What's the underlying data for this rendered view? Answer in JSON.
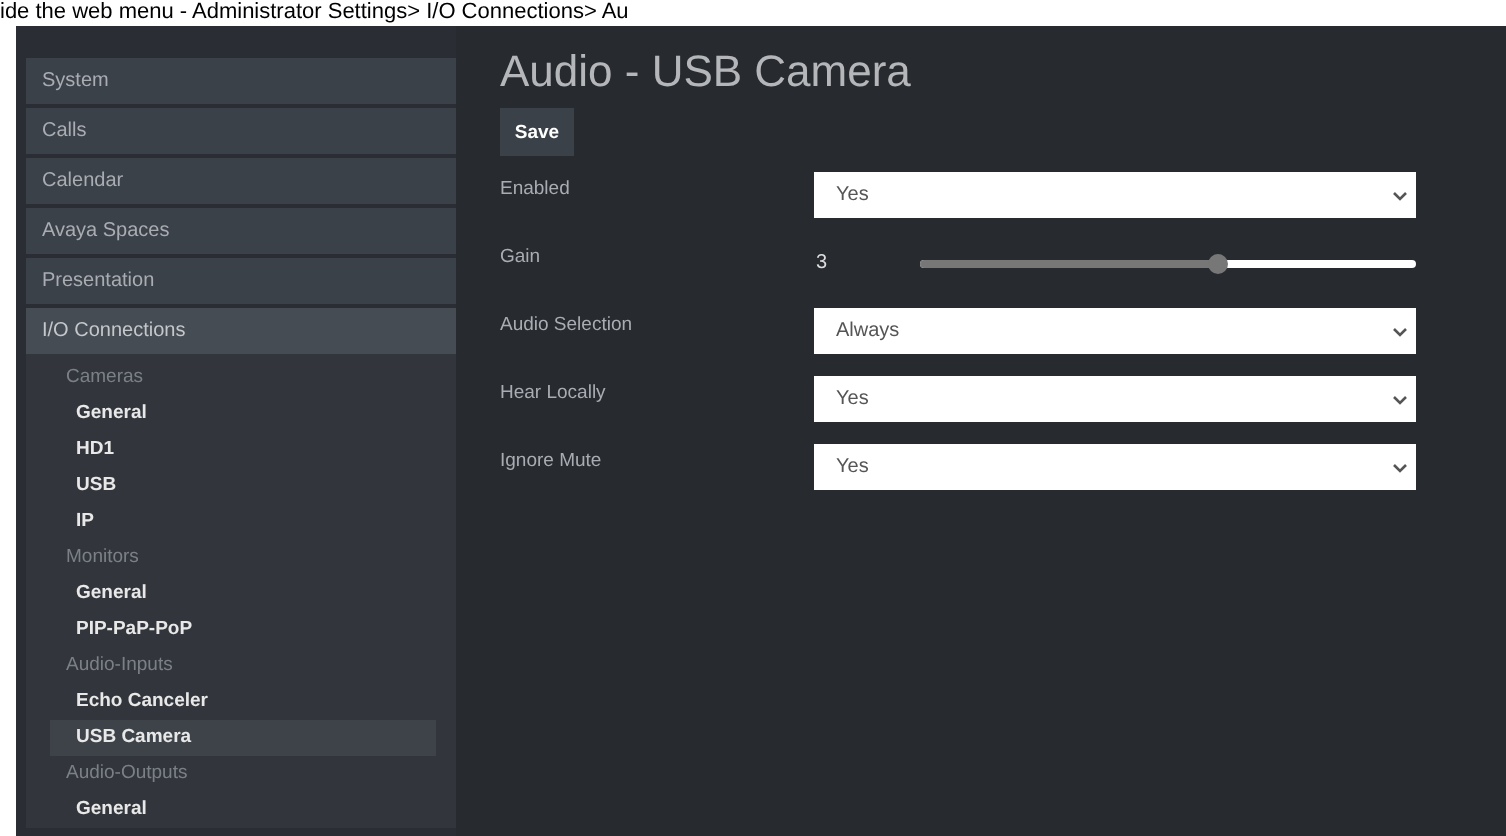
{
  "caption": "ide the web menu - Administrator Settings> I/O Connections> Au",
  "sidebar": {
    "items": [
      {
        "label": "System",
        "selected": false
      },
      {
        "label": "Calls",
        "selected": false
      },
      {
        "label": "Calendar",
        "selected": false
      },
      {
        "label": "Avaya Spaces",
        "selected": false
      },
      {
        "label": "Presentation",
        "selected": false
      },
      {
        "label": "I/O Connections",
        "selected": false,
        "expanded": true,
        "children": [
          {
            "label": "Cameras",
            "children": [
              {
                "label": "General",
                "selected": false
              },
              {
                "label": "HD1",
                "selected": false
              },
              {
                "label": "USB",
                "selected": false
              },
              {
                "label": "IP",
                "selected": false
              }
            ]
          },
          {
            "label": "Monitors",
            "children": [
              {
                "label": "General",
                "selected": false
              },
              {
                "label": "PIP-PaP-PoP",
                "selected": false
              }
            ]
          },
          {
            "label": "Audio-Inputs",
            "children": [
              {
                "label": "Echo Canceler",
                "selected": false
              },
              {
                "label": "USB Camera",
                "selected": true
              }
            ]
          },
          {
            "label": "Audio-Outputs",
            "children": [
              {
                "label": "General",
                "selected": false
              }
            ]
          }
        ]
      }
    ]
  },
  "page": {
    "title": "Audio - USB Camera",
    "save_button": "Save",
    "fields": [
      {
        "kind": "select",
        "label": "Enabled",
        "value": "Yes"
      },
      {
        "kind": "slider",
        "label": "Gain",
        "value": "3",
        "level": 0.6
      },
      {
        "kind": "select",
        "label": "Audio Selection",
        "value": "Always"
      },
      {
        "kind": "select",
        "label": "Hear Locally",
        "value": "Yes"
      },
      {
        "kind": "select",
        "label": "Ignore Mute",
        "value": "Yes"
      }
    ]
  }
}
